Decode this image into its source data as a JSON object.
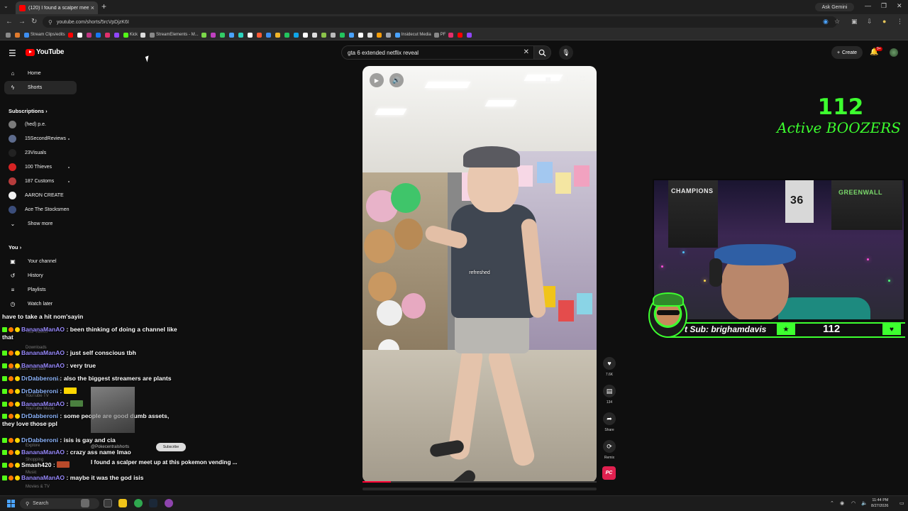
{
  "browser": {
    "tab_title": "(120) I found a scalper meet up",
    "url": "youtube.com/shorts/5rcVpDjzK6I",
    "ask_gemini": "Ask Gemini",
    "bookmarks": [
      "Stream Clips/edits",
      "Kick",
      "StreamElements - M...",
      "Insidecut Media",
      "PF"
    ]
  },
  "youtube": {
    "logo": "YouTube",
    "search_value": "gta 6 extended netflix reveal",
    "create_label": "Create",
    "notification_count": "9+"
  },
  "sidebar": {
    "home": "Home",
    "shorts": "Shorts",
    "subscriptions_heading": "Subscriptions",
    "subscriptions": [
      {
        "name": "(hed) p.e.",
        "color": "#7a7a7a"
      },
      {
        "name": "15SecondReviews",
        "color": "#5d6b8c"
      },
      {
        "name": "23Visuals",
        "color": "#222222"
      },
      {
        "name": "100 Thieves",
        "color": "#d62323"
      },
      {
        "name": "187 Customs",
        "color": "#b63c3c"
      },
      {
        "name": "AARON CREATE",
        "color": "#f0f0f0"
      },
      {
        "name": "Ace The Stocksmen",
        "color": "#3b4d7a"
      }
    ],
    "show_more": "Show more",
    "you_heading": "You",
    "you_items": [
      "Your channel",
      "History",
      "Playlists",
      "Watch later"
    ]
  },
  "chat": {
    "first_line": "have to take a hit nom'sayin",
    "messages": [
      {
        "user": "BananaManAO",
        "text": "been thinking of doing a channel like that",
        "color": "nick-b"
      },
      {
        "user": "BananaManAO",
        "text": "just self conscious tbh",
        "color": "nick-b"
      },
      {
        "user": "BananaManAO",
        "text": "very true",
        "color": "nick-b"
      },
      {
        "user": "DrDabberoni",
        "text": "also the biggest streamers are plants",
        "color": "nick-d"
      },
      {
        "user": "DrDabberoni",
        "text": "",
        "color": "nick-d"
      },
      {
        "user": "BananaManAO",
        "text": "",
        "color": "nick-b"
      },
      {
        "user": "DrDabberoni",
        "text": "some people are good dumb assets, they love those ppl",
        "color": "nick-d"
      },
      {
        "user": "DrDabberoni",
        "text": "isis is gay and cia",
        "color": "nick-d"
      },
      {
        "user": "BananaManAO",
        "text": "crazy ass name lmao",
        "color": "nick-b"
      },
      {
        "user": "Smash420",
        "text": "",
        "color": "nick-s"
      },
      {
        "user": "BananaManAO",
        "text": "maybe it was the god isis",
        "color": "nick-b"
      }
    ],
    "ghost_labels": [
      "Your videos",
      "Downloads",
      "More from YouTube",
      "YouTube Premium",
      "YouTube TV",
      "YouTube Music",
      "YouTube Kids",
      "Explore",
      "Shopping",
      "Music",
      "Movies & TV"
    ]
  },
  "short": {
    "caption": "I found a scalper meet up at this pokemon vending ...",
    "watermark": "refreshed",
    "subscribe": "Subscribe",
    "channel": "@Pokecentralshorts",
    "progress": 0.12,
    "actions": [
      {
        "icon": "like-icon",
        "glyph": "♥",
        "label": "7.6K"
      },
      {
        "icon": "comment-icon",
        "glyph": "▤",
        "label": "134"
      },
      {
        "icon": "share-icon",
        "glyph": "➦",
        "label": "Share"
      },
      {
        "icon": "remix-icon",
        "glyph": "⟳",
        "label": "Remix"
      }
    ],
    "brand_badge": "PC"
  },
  "overlay": {
    "active_count": "112",
    "active_label": "Active BOOZERS",
    "sub_text": "t Sub: brighamdavis",
    "sub_count": "112",
    "cam_banner_left": "CHAMPIONS",
    "cam_banner_right": "GREENWALL",
    "cam_jersey": "36",
    "accent": "#3dff2f"
  },
  "taskbar": {
    "search": "Search",
    "time": "11:44 PM",
    "date": "8/27/2026"
  }
}
